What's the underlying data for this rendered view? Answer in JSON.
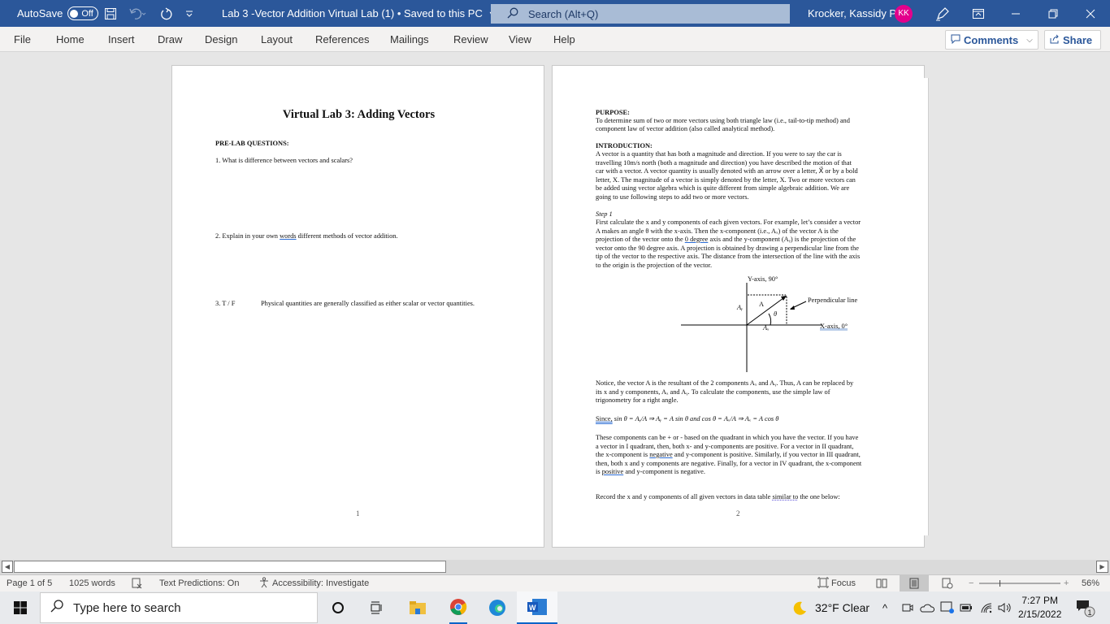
{
  "titlebar": {
    "autosave_label": "AutoSave",
    "autosave_state": "Off",
    "doc_title": "Lab 3 -Vector Addition Virtual Lab (1) • Saved to this PC",
    "search_placeholder": "Search (Alt+Q)",
    "user_name": "Krocker, Kassidy P",
    "user_initials": "KK",
    "accent_color": "#2b579a",
    "avatar_color": "#e3008c"
  },
  "ribbon": {
    "tabs": [
      "File",
      "Home",
      "Insert",
      "Draw",
      "Design",
      "Layout",
      "References",
      "Mailings",
      "Review",
      "View",
      "Help"
    ],
    "comments_label": "Comments",
    "share_label": "Share"
  },
  "page1": {
    "title": "Virtual Lab 3: Adding Vectors",
    "section": "PRE-LAB QUESTIONS:",
    "q1": "1.   What is difference between vectors and scalars?",
    "q2_pre": "2.   Explain in your own ",
    "q2_flag": "words",
    "q2_post": " different methods of vector addition.",
    "q3_num": "3.   T / F",
    "q3_text": "Physical quantities are generally classified as either scalar or vector quantities.",
    "page_number": "1"
  },
  "page2": {
    "purpose_heading": "PURPOSE:",
    "purpose_l1": "To determine sum of two or more vectors using both triangle law (i.e., tail-to-tip method) and",
    "purpose_l2": "component law of vector addition (also called analytical method).",
    "intro_heading": "INTRODUCTION:",
    "intro_lines": [
      "A vector is a quantity that has both a magnitude and direction. If you were to say the car is",
      "travelling 10m/s north (both a magnitude and direction) you have described the motion of that",
      "car with a vector. A vector quantity is usually denoted with an arrow over a letter, X⃗ or by a bold",
      "letter, X. The magnitude of a vector is simply denoted by the letter, X. Two or more vectors can",
      "be added using vector algebra which is quite different from simple algebraic addition. We are",
      "going to use following steps to add two or more vectors."
    ],
    "step_heading": "Step 1",
    "step_l1": "First calculate the x and y components of each given vectors. For example, let’s consider a vector",
    "step_l2": "A makes an angle θ with the x-axis. Then the x-component (i.e., Aₓ) of the vector A is the",
    "step_l3_pre": "projection of the vector onto the ",
    "step_l3_flag": "0 degree",
    "step_l3_post": " axis and the y-component (Aᵧ) is the projection of the",
    "step_l4": "vector onto the 90 degree axis. A projection is obtained by drawing a perpendicular line from the",
    "step_l5": "tip of the vector to the respective axis. The distance from the intersection of the line with the axis",
    "step_l6": "to the origin is the projection of the vector.",
    "diagram": {
      "y_axis_label": "Y-axis, 90°",
      "x_axis_label": "X-axis,   0°",
      "vector_label": "A",
      "angle_label": "θ",
      "ay_label": "Aᵧ",
      "ax_label": "Aₓ",
      "perp_label": "Perpendicular line"
    },
    "notice_lines": [
      "Notice, the vector A is the resultant of the 2 components Aₓ and Aᵧ. Thus, A can be replaced by",
      "its x and y components, Aₓ and Aᵧ. To calculate the components, use the simple law of",
      "trigonometry for a right angle."
    ],
    "since_word": "Since,",
    "formula": " sin θ = Aᵧ/A ⇒ Aᵧ = A sin θ    and  cos θ = Aₓ/A ⇒ Aₓ = A cos θ",
    "quad_l1": "These components can be + or - based on the quadrant in which you have the vector. If you have",
    "quad_l2": "a vector in I quadrant, then, both x- and y-components are positive. For a vector in II quadrant,",
    "quad_l3_pre": "the x-component is ",
    "quad_l3_flag": "negative",
    "quad_l3_post": " and y-component is positive. Similarly, if you vector in III quadrant,",
    "quad_l4": "then, both x and y components are negative. Finally, for a vector in IV quadrant, the x-component",
    "quad_l5_pre": "is ",
    "quad_l5_flag": "positive",
    "quad_l5_post": " and y-component is negative.",
    "record_pre": "Record the x and y components of all given vectors in data table ",
    "record_flag": "similar to",
    "record_post": " the one below:",
    "page_number": "2"
  },
  "statusbar": {
    "page": "Page 1 of 5",
    "words": "1025 words",
    "text_predictions": "Text Predictions: On",
    "accessibility": "Accessibility: Investigate",
    "focus": "Focus",
    "zoom_percent": "56%",
    "zoom_value": 56
  },
  "taskbar": {
    "search_placeholder": "Type here to search",
    "weather": "32°F  Clear",
    "time": "7:27 PM",
    "date": "2/15/2022",
    "notification_count": "1"
  }
}
